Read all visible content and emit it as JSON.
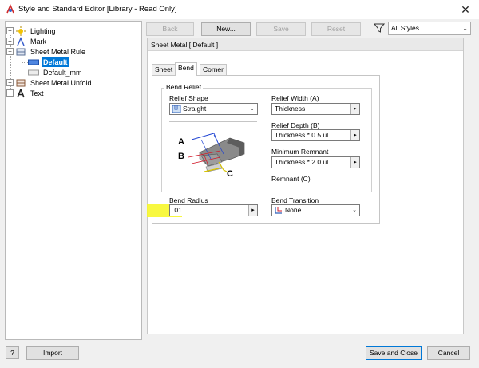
{
  "window": {
    "title": "Style and Standard Editor [Library - Read Only]",
    "close_glyph": "✕"
  },
  "tree": {
    "items": [
      {
        "label": "Lighting",
        "expander": "+"
      },
      {
        "label": "Mark",
        "expander": "+"
      },
      {
        "label": "Sheet Metal Rule",
        "expander": "−"
      },
      {
        "label": "Default",
        "selected": true
      },
      {
        "label": "Default_mm"
      },
      {
        "label": "Sheet Metal Unfold",
        "expander": "+"
      },
      {
        "label": "Text",
        "expander": "+"
      }
    ]
  },
  "toolbar": {
    "back": "Back",
    "new": "New...",
    "save": "Save",
    "reset": "Reset",
    "filter_value": "All Styles"
  },
  "panel": {
    "header": "Sheet Metal [ Default ]",
    "tabs": [
      "Sheet",
      "Bend",
      "Corner"
    ],
    "active_tab": "Bend",
    "bend_relief": {
      "caption": "Bend Relief",
      "relief_shape_label": "Relief Shape",
      "relief_shape_value": "Straight",
      "relief_width_label": "Relief Width (A)",
      "relief_width_value": "Thickness",
      "relief_depth_label": "Relief Depth (B)",
      "relief_depth_value": "Thickness * 0.5 ul",
      "min_remnant_label": "Minimum Remnant",
      "min_remnant_value": "Thickness * 2.0 ul",
      "remnant_label": "Remnant (C)",
      "diagram_labels": [
        "A",
        "B",
        "C"
      ]
    },
    "bend_radius_label": "Bend Radius",
    "bend_radius_value": ".01",
    "bend_transition_label": "Bend Transition",
    "bend_transition_value": "None"
  },
  "footer": {
    "help": "?",
    "import": "Import",
    "save_close": "Save and Close",
    "cancel": "Cancel"
  },
  "colors": {
    "selection": "#0078d7",
    "highlight": "#f7f72b",
    "annotation_blue": "#1a3fd1",
    "annotation_red": "#d11a2a",
    "annotation_yellow": "#d8c400"
  }
}
